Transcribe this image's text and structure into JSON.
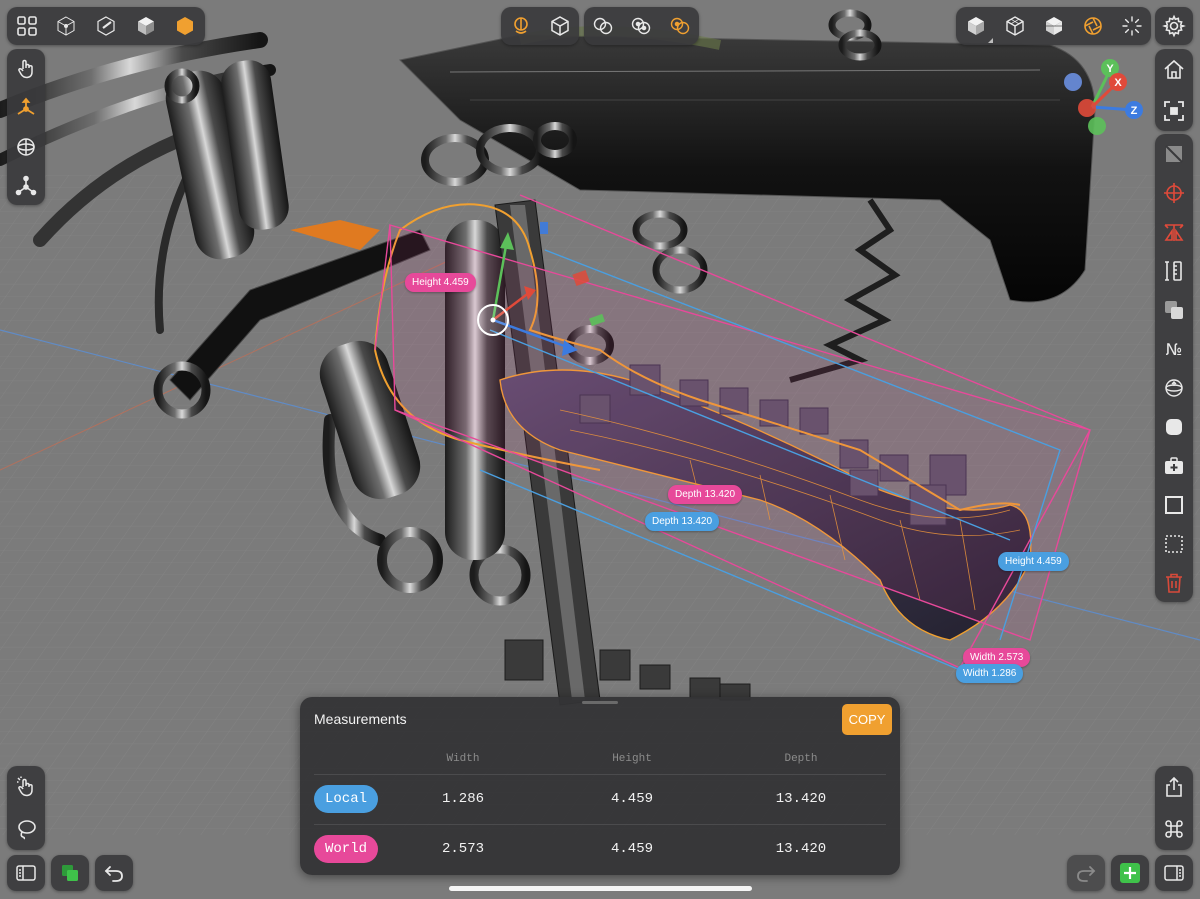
{
  "colors": {
    "accent": "#f0a030",
    "pink": "#e7499a",
    "blue": "#4a9fe0",
    "axis_x": "#e04a3a",
    "axis_y": "#5cc05a",
    "axis_z": "#3c7be0",
    "add_green": "#3fc24a",
    "delete_red": "#d84a3a"
  },
  "top_toolbar": {
    "left_group": [
      "grid-apps-icon",
      "shading-wireframe-icon",
      "shading-outline-icon",
      "shading-solid-icon",
      "shading-material-icon"
    ],
    "center_group_1": [
      "pivot-orbit-icon",
      "view-cube-icon"
    ],
    "center_group_2": [
      "snap-points-icon",
      "snap-objects-icon",
      "snap-center-icon"
    ],
    "right_group": [
      "render-solid-icon",
      "render-wire-icon",
      "render-faceted-icon",
      "render-lens-icon",
      "render-lighting-icon"
    ],
    "settings": "gear-icon"
  },
  "left_toolbar": {
    "tools": [
      "touch-select-icon",
      "move-gizmo-icon",
      "rotate-gizmo-icon",
      "transform-tripod-icon"
    ],
    "bottom": [
      "tap-select-icon",
      "lasso-select-icon",
      "sidebar-toggle-icon",
      "layers-icon",
      "undo-icon"
    ]
  },
  "right_toolbar": {
    "top": [
      "home-icon",
      "frame-selection-icon"
    ],
    "tools": [
      "no-clipping-icon",
      "target-icon",
      "symmetry-icon",
      "measure-icon",
      "boolean-icon",
      "numbering-icon",
      "sphere-icon",
      "rounded-box-icon",
      "add-plus-box-icon",
      "square-outline-icon",
      "dotted-square-icon",
      "trash-icon"
    ],
    "bottom": [
      "share-icon",
      "command-icon",
      "sidebar-right-icon",
      "add-plus-icon",
      "redo-icon"
    ]
  },
  "gizmo_axes": {
    "x": "X",
    "y": "Y",
    "z": "Z"
  },
  "viewport_labels": {
    "height_left": "Height 4.459",
    "depth_world": "Depth 13.420",
    "depth_local": "Depth 13.420",
    "height_right": "Height 4.459",
    "width_world": "Width 2.573",
    "width_local": "Width 1.286"
  },
  "measurements": {
    "title": "Measurements",
    "copy_label": "COPY",
    "columns": [
      "Width",
      "Height",
      "Depth"
    ],
    "rows": [
      {
        "label": "Local",
        "color": "#4a9fe0",
        "values": [
          "1.286",
          "4.459",
          "13.420"
        ]
      },
      {
        "label": "World",
        "color": "#e7499a",
        "values": [
          "2.573",
          "4.459",
          "13.420"
        ]
      }
    ]
  }
}
